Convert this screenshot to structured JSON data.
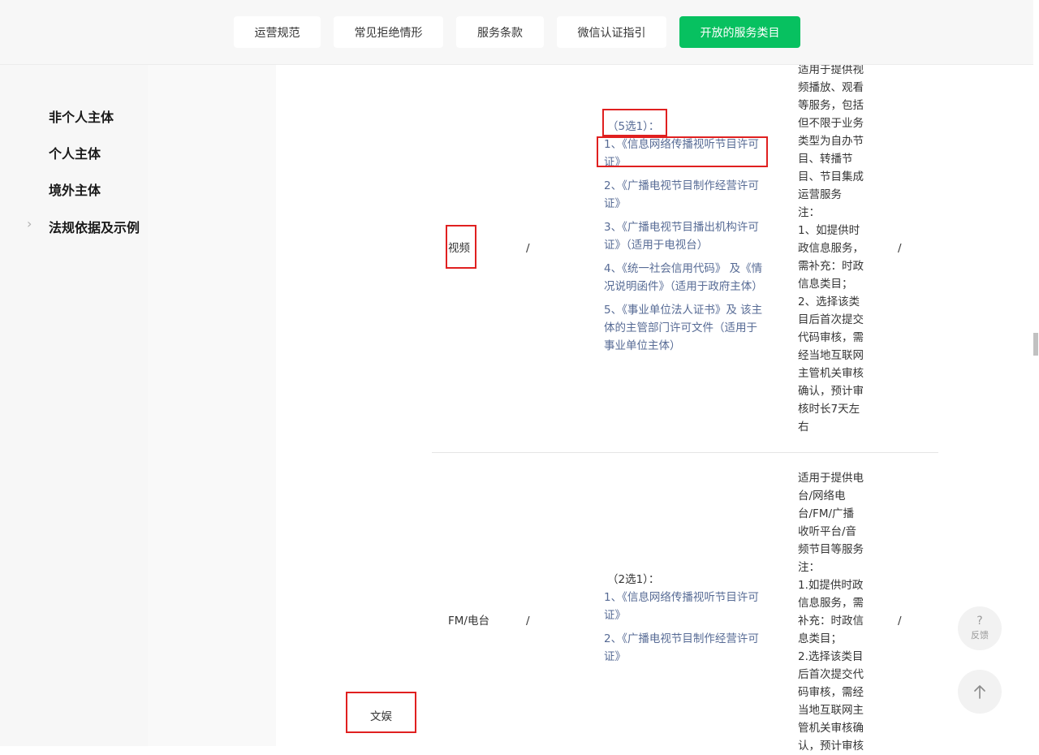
{
  "top_tabs": [
    {
      "label": "运营规范",
      "active": false
    },
    {
      "label": "常见拒绝情形",
      "active": false
    },
    {
      "label": "服务条款",
      "active": false
    },
    {
      "label": "微信认证指引",
      "active": false
    },
    {
      "label": "开放的服务类目",
      "active": true
    }
  ],
  "sidebar": {
    "items": [
      {
        "label": "非个人主体"
      },
      {
        "label": "个人主体"
      },
      {
        "label": "境外主体"
      },
      {
        "label": "法规依据及示例",
        "chevron": "›"
      }
    ]
  },
  "table": {
    "category_label": "文娱",
    "rows": [
      {
        "name": "视频",
        "col2": "/",
        "qualifications": [
          "（5选1）：",
          "1、《信息网络传播视听节目许可证》",
          "2、《广播电视节目制作经营许可证》",
          "3、《广播电视节目播出机构许可证》（适用于电视台）",
          "4、《统一社会信用代码》 及《情况说明函件》（适用于政府主体）",
          "5、《事业单位法人证书》及 该主体的主管部门许可文件（适用于事业单位主体）"
        ],
        "note": [
          "适用于提供视",
          "频播放、观看",
          "等服务，包括",
          "但不限于业务",
          "类型为自办节",
          "目、转播节",
          "目、节目集成",
          "运营服务",
          "注：",
          "1、如提供时",
          "政信息服务，",
          "需补充：时政",
          "信息类目；",
          "2、选择该类",
          "目后首次提交",
          "代码审核，需",
          "经当地互联网",
          "主管机关审核",
          "确认，预计审",
          "核时长7天左",
          "右"
        ],
        "col5": "/"
      },
      {
        "name": "FM/电台",
        "col2": "/",
        "qualifications": [
          "（2选1）：",
          "1、《信息网络传播视听节目许可证》",
          "2、《广播电视节目制作经营许可证》"
        ],
        "note": [
          "适用于提供电",
          "台/网络电",
          "台/FM/广播",
          "收听平台/音",
          "频节目等服务",
          "注：",
          "1.如提供时政",
          "信息服务，需",
          "补充：时政信",
          "息类目；",
          "2.选择该类目",
          "后首次提交代",
          "码审核，需经",
          "当地互联网主",
          "管机关审核确",
          "认，预计审核"
        ],
        "col5": "/"
      }
    ]
  },
  "fab": {
    "feedback_icon": "?",
    "feedback_label": "反馈",
    "top_icon": "arrow-up-icon"
  },
  "colors": {
    "accent": "#07c160",
    "link": "#576b95",
    "highlight_box": "#e02020"
  }
}
